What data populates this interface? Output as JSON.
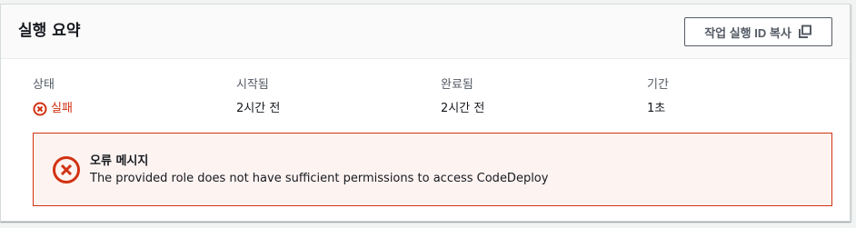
{
  "panel": {
    "title": "실행 요약",
    "copy_button_label": "작업 실행 ID 복사",
    "copy_icon": "copy-icon"
  },
  "summary": {
    "status": {
      "label": "상태",
      "value": "실패",
      "icon": "error-circle-icon",
      "color": "#d13212"
    },
    "started": {
      "label": "시작됨",
      "value": "2시간 전"
    },
    "completed": {
      "label": "완료됨",
      "value": "2시간 전"
    },
    "duration": {
      "label": "기간",
      "value": "1초"
    }
  },
  "error": {
    "title": "오류 메시지",
    "message": "The provided role does not have sufficient permissions to access CodeDeploy",
    "icon": "error-circle-icon",
    "border_color": "#d13212",
    "background_color": "#fdf3f1"
  }
}
